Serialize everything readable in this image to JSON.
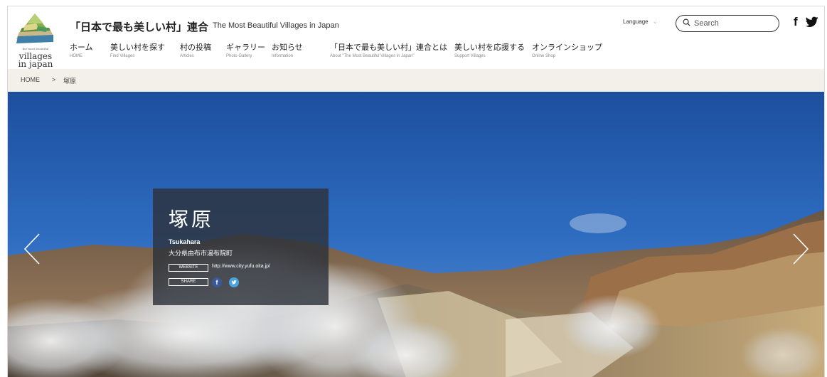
{
  "header": {
    "logo_small_text": "the most beautiful",
    "logo_line1": "villages",
    "logo_line2": "in japan",
    "site_title": "「日本で最も美しい村」連合",
    "site_subtitle": "The Most Beautiful Villages in Japan",
    "language_label": "Language",
    "search_placeholder": "Search",
    "facebook_label": "f"
  },
  "nav": [
    {
      "ja": "ホーム",
      "en": "HOME"
    },
    {
      "ja": "美しい村を探す",
      "en": "Find Villages"
    },
    {
      "ja": "村の投稿",
      "en": "Articles"
    },
    {
      "ja": "ギャラリー",
      "en": "Photo Gallery"
    },
    {
      "ja": "お知らせ",
      "en": "Information"
    },
    {
      "ja": "「日本で最も美しい村」連合とは",
      "en": "About \"The Most Beautiful Villages in Japan\""
    },
    {
      "ja": "美しい村を応援する",
      "en": "Support Villages"
    },
    {
      "ja": "オンラインショップ",
      "en": "Online Shop"
    }
  ],
  "breadcrumb": {
    "home": "HOME",
    "separator": ">",
    "current": "塚原"
  },
  "village": {
    "name": "塚原",
    "romanized": "Tsukahara",
    "address": "大分県由布市湯布院町",
    "website_tag": "WEBSITE",
    "website_url": "http://www.city.yufu.oita.jp/",
    "share_tag": "SHARE",
    "share_facebook": "f"
  },
  "colors": {
    "breadcrumb_bg": "#f3f0e9",
    "info_panel_bg": "#2d323a",
    "facebook_blue": "#3b5998",
    "twitter_blue": "#4aa3df"
  },
  "icons": [
    "logo-icon",
    "search-icon",
    "facebook-icon",
    "twitter-icon",
    "chevron-left-icon",
    "chevron-right-icon",
    "chevron-down-icon"
  ]
}
